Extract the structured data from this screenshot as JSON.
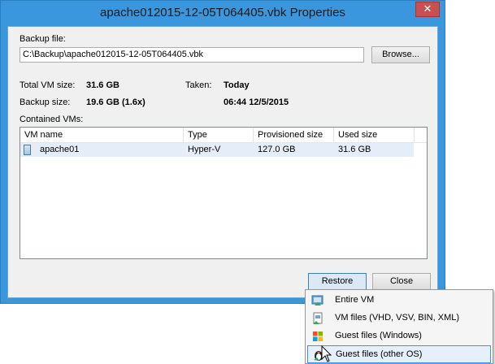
{
  "window": {
    "title": "apache012015-12-05T064405.vbk Properties",
    "close_glyph": "✕"
  },
  "backup_file": {
    "label": "Backup file:",
    "path": "C:\\Backup\\apache012015-12-05T064405.vbk",
    "browse_label": "Browse..."
  },
  "summary": {
    "total_vm_size_label": "Total VM size:",
    "total_vm_size_value": "31.6 GB",
    "backup_size_label": "Backup size:",
    "backup_size_value": "19.6 GB (1.6x)",
    "taken_label": "Taken:",
    "taken_value": "Today",
    "taken_time": "06:44 12/5/2015"
  },
  "contained_vms": {
    "label": "Contained VMs:",
    "columns": [
      "VM name",
      "Type",
      "Provisioned size",
      "Used size"
    ],
    "rows": [
      {
        "name": "apache01",
        "type": "Hyper-V",
        "provisioned": "127.0 GB",
        "used": "31.6 GB"
      }
    ]
  },
  "buttons": {
    "restore": "Restore",
    "close": "Close"
  },
  "restore_menu": {
    "items": [
      {
        "label": "Entire VM",
        "icon": "entire-vm-icon"
      },
      {
        "label": "VM files (VHD, VSV, BIN, XML)",
        "icon": "vm-files-icon"
      },
      {
        "label": "Guest files (Windows)",
        "icon": "windows-logo-icon"
      },
      {
        "label": "Guest files (other OS)",
        "icon": "linux-penguin-icon"
      }
    ],
    "highlighted_index": 3
  },
  "colors": {
    "window_frame": "#3a96dd",
    "selection": "#e5eef8",
    "menu_highlight": "#e6f0fb"
  }
}
